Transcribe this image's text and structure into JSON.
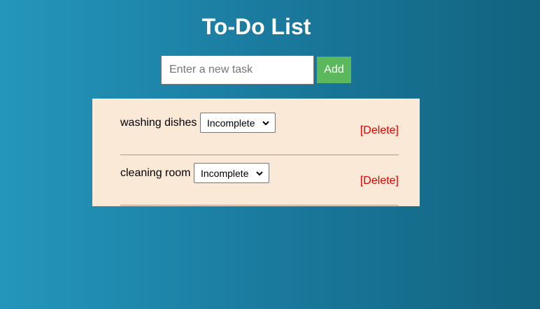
{
  "header": {
    "title": "To-Do List"
  },
  "form": {
    "input_placeholder": "Enter a new task",
    "input_value": "",
    "add_label": "Add"
  },
  "tasks": [
    {
      "name": "washing dishes",
      "status": "Incomplete",
      "delete_label": "[Delete]"
    },
    {
      "name": "cleaning room",
      "status": "Incomplete",
      "delete_label": "[Delete]"
    }
  ],
  "colors": {
    "add_button": "#5cb85c",
    "panel_background": "#fae9d6",
    "delete_text": "#e00000"
  }
}
